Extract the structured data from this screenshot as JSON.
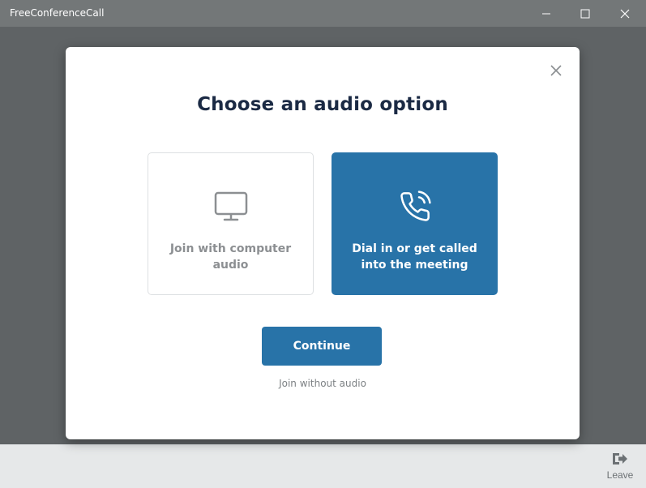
{
  "window": {
    "title": "FreeConferenceCall",
    "controls": [
      "minimize-icon",
      "maximize-icon",
      "close-icon"
    ]
  },
  "modal": {
    "title": "Choose an audio option",
    "options": [
      {
        "icon": "monitor-icon",
        "label": "Join with computer audio",
        "selected": false
      },
      {
        "icon": "phone-call-icon",
        "label": "Dial in or get called into the meeting",
        "selected": true
      }
    ],
    "continue_label": "Continue",
    "no_audio_label": "Join without audio"
  },
  "bottom_bar": {
    "leave_icon": "leave-icon",
    "leave_label": "Leave"
  },
  "colors": {
    "accent": "#2873a8",
    "title_text": "#1b2a44",
    "titlebar_bg": "#737778",
    "overlay_bg": "#5f6365"
  }
}
